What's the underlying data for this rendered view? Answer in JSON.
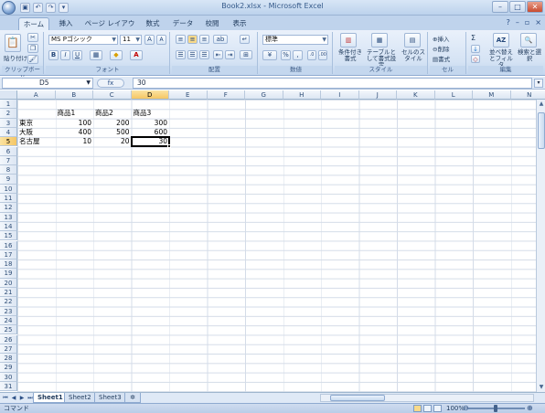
{
  "window": {
    "title": "Book2.xlsx - Microsoft Excel",
    "buttons": [
      "–",
      "□",
      "✕"
    ]
  },
  "qat": [
    "▣",
    "↶",
    "↷",
    "▾"
  ],
  "tabs": [
    "ホーム",
    "挿入",
    "ページ レイアウト",
    "数式",
    "データ",
    "校閲",
    "表示"
  ],
  "ribbon": {
    "clipboard": {
      "paste": "貼り付け",
      "label": "クリップボード"
    },
    "font": {
      "name": "MS Pゴシック",
      "size": "11",
      "label": "フォント",
      "bold": "B",
      "italic": "I",
      "underline": "U"
    },
    "alignment": {
      "label": "配置"
    },
    "number": {
      "format": "標準",
      "label": "数値",
      "percent": "%",
      "comma": ","
    },
    "styles": {
      "conditional": "条件付き書式",
      "table": "テーブルとして書式設定",
      "cell": "セルのスタイル",
      "label": "スタイル"
    },
    "cells": {
      "insert": "挿入",
      "delete": "削除",
      "format": "書式",
      "label": "セル"
    },
    "editing": {
      "sum": "Σ",
      "sort": "並べ替えとフィルタ",
      "find": "検索と選択",
      "label": "編集"
    }
  },
  "formula_bar": {
    "name_box": "D5",
    "fx": "fx",
    "value": "30"
  },
  "columns": [
    "A",
    "B",
    "C",
    "D",
    "E",
    "F",
    "G",
    "H",
    "I",
    "J",
    "K",
    "L",
    "M",
    "N"
  ],
  "selected_col": "D",
  "selected_row": 5,
  "rows": [
    "1",
    "2",
    "3",
    "4",
    "5",
    "6",
    "7",
    "8",
    "9",
    "10",
    "11",
    "12",
    "13",
    "14",
    "15",
    "16",
    "17",
    "18",
    "19",
    "20",
    "21",
    "22",
    "23",
    "24",
    "25",
    "26",
    "27",
    "28",
    "29",
    "30",
    "31"
  ],
  "cells": {
    "B2": "商品1",
    "C2": "商品2",
    "D2": "商品3",
    "A3": "東京",
    "B3": "100",
    "C3": "200",
    "D3": "300",
    "A4": "大阪",
    "B4": "400",
    "C4": "500",
    "D4": "600",
    "A5": "名古屋",
    "B5": "10",
    "C5": "20",
    "D5": "30"
  },
  "sheet_tabs": [
    "Sheet1",
    "Sheet2",
    "Sheet3"
  ],
  "active_sheet": "Sheet1",
  "status": {
    "mode": "コマンド",
    "zoom": "100%"
  }
}
